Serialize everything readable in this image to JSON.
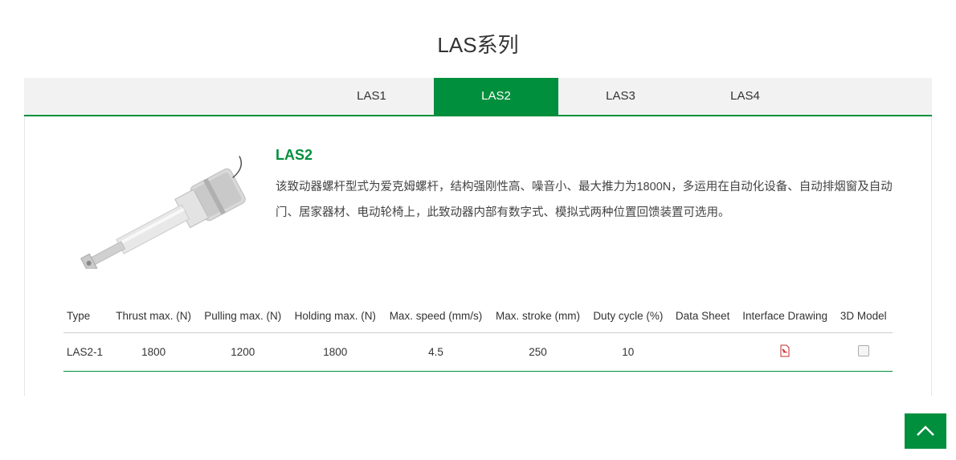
{
  "page_title": "LAS系列",
  "tabs": [
    {
      "label": "LAS1",
      "active": false
    },
    {
      "label": "LAS2",
      "active": true
    },
    {
      "label": "LAS3",
      "active": false
    },
    {
      "label": "LAS4",
      "active": false
    }
  ],
  "product": {
    "name": "LAS2",
    "description": "该致动器螺杆型式为爱克姆螺杆，结构强刚性高、噪音小、最大推力为1800N，多运用在自动化设备、自动排烟窗及自动门、居家器材、电动轮椅上，此致动器内部有数字式、模拟式两种位置回馈装置可选用。"
  },
  "spec_table": {
    "headers": [
      "Type",
      "Thrust max. (N)",
      "Pulling max. (N)",
      "Holding max. (N)",
      "Max. speed (mm/s)",
      "Max. stroke (mm)",
      "Duty cycle (%)",
      "Data Sheet",
      "Interface Drawing",
      "3D Model"
    ],
    "rows": [
      {
        "type": "LAS2-1",
        "thrust": "1800",
        "pulling": "1200",
        "holding": "1800",
        "speed": "4.5",
        "stroke": "250",
        "duty": "10",
        "datasheet": "",
        "interface": "pdf",
        "model3d": "doc"
      }
    ]
  }
}
